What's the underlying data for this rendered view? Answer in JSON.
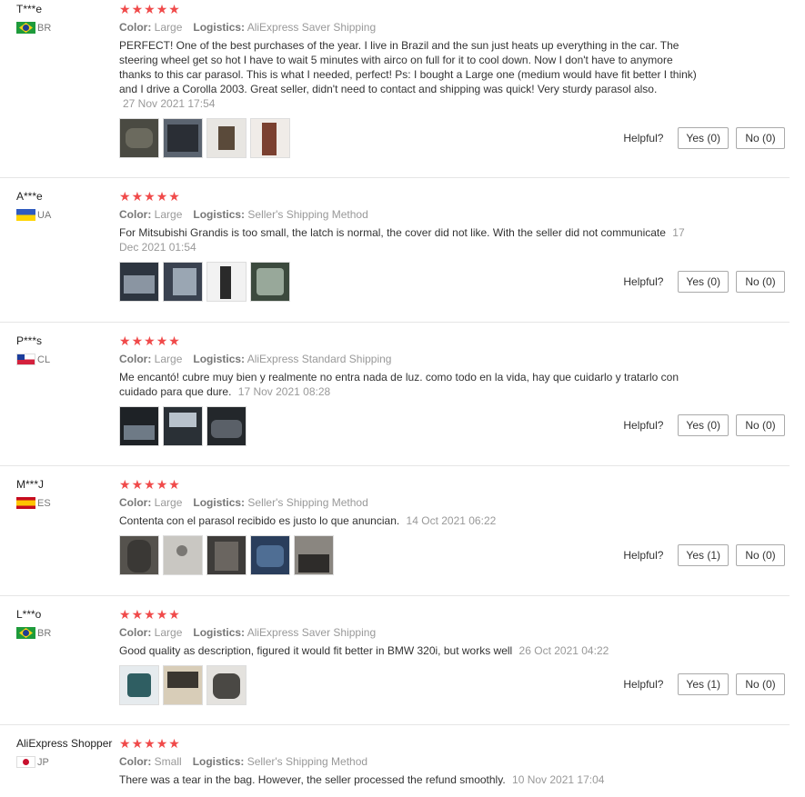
{
  "labels": {
    "color": "Color:",
    "logistics": "Logistics:",
    "helpful": "Helpful?",
    "yes": "Yes",
    "no": "No"
  },
  "star_color": "#f04a4a",
  "reviews": [
    {
      "user": "T***e",
      "country": "BR",
      "flag_icon": "brazil-flag-icon",
      "rating": 5,
      "color": "Large",
      "logistics": "AliExpress Saver Shipping",
      "text": "PERFECT! One of the best purchases of the year. I live in Brazil and the sun just heats up everything in the car. The steering wheel get so hot I have to wait 5 minutes with airco on full for it to cool down. Now I don't have to anymore thanks to this car parasol. This is what I needed, perfect! Ps: I bought a Large one (medium would have fit better I think) and I drive a Corolla 2003. Great seller, didn't need to contact and shipping was quick! Very sturdy parasol also.",
      "date": "27 Nov 2021 17:54",
      "yes_label": "Yes (0)",
      "no_label": "No (0)"
    },
    {
      "user": "A***e",
      "country": "UA",
      "flag_icon": "ukraine-flag-icon",
      "rating": 5,
      "color": "Large",
      "logistics": "Seller's Shipping Method",
      "text": "For Mitsubishi Grandis is too small, the latch is normal, the cover did not like. With the seller did not communicate",
      "date": "17 Dec 2021 01:54",
      "yes_label": "Yes (0)",
      "no_label": "No (0)"
    },
    {
      "user": "P***s",
      "country": "CL",
      "flag_icon": "chile-flag-icon",
      "rating": 5,
      "color": "Large",
      "logistics": "AliExpress Standard Shipping",
      "text": "Me encantó! cubre muy bien y realmente no entra nada de luz. como todo en la vida, hay que cuidarlo y tratarlo con cuidado para que dure.",
      "date": "17 Nov 2021 08:28",
      "yes_label": "Yes (0)",
      "no_label": "No (0)"
    },
    {
      "user": "M***J",
      "country": "ES",
      "flag_icon": "spain-flag-icon",
      "rating": 5,
      "color": "Large",
      "logistics": "Seller's Shipping Method",
      "text": "Contenta con el parasol recibido es justo lo que anuncian.",
      "date": "14 Oct 2021 06:22",
      "yes_label": "Yes (1)",
      "no_label": "No (0)"
    },
    {
      "user": "L***o",
      "country": "BR",
      "flag_icon": "brazil-flag-icon",
      "rating": 5,
      "color": "Large",
      "logistics": "AliExpress Saver Shipping",
      "text": "Good quality as description, figured it would fit better in BMW 320i, but works well",
      "date": "26 Oct 2021 04:22",
      "yes_label": "Yes (1)",
      "no_label": "No (0)"
    },
    {
      "user": "AliExpress Shopper",
      "country": "JP",
      "flag_icon": "japan-flag-icon",
      "rating": 5,
      "color": "Small",
      "logistics": "Seller's Shipping Method",
      "text": "There was a tear in the bag. However, the seller processed the refund smoothly.",
      "date": "10 Nov 2021 17:04"
    }
  ]
}
